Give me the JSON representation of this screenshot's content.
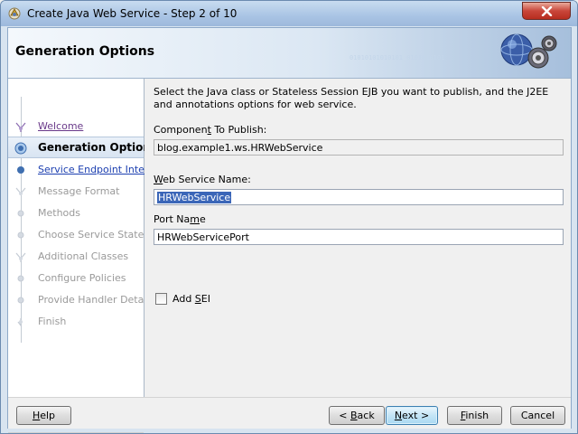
{
  "window": {
    "title": "Create Java Web Service - Step 2 of 10"
  },
  "header": {
    "title": "Generation Options",
    "decor_text": "01010101010101 0101010101"
  },
  "nav": {
    "items": [
      {
        "label": "Welcome",
        "state": "visited"
      },
      {
        "label": "Generation Options",
        "state": "active"
      },
      {
        "label": "Service Endpoint Interfa",
        "state": "link"
      },
      {
        "label": "Message Format",
        "state": "disabled"
      },
      {
        "label": "Methods",
        "state": "disabled"
      },
      {
        "label": "Choose Service State",
        "state": "disabled"
      },
      {
        "label": "Additional Classes",
        "state": "disabled"
      },
      {
        "label": "Configure Policies",
        "state": "disabled"
      },
      {
        "label": "Provide Handler Details",
        "state": "disabled"
      },
      {
        "label": "Finish",
        "state": "disabled"
      }
    ]
  },
  "form": {
    "description": "Select the Java class or Stateless Session EJB you want to publish, and the J2EE and annotations options for web service.",
    "component_label_pre": "Componen",
    "component_label_mn": "t",
    "component_label_post": " To Publish:",
    "component_value": "blog.example1.ws.HRWebService",
    "ws_name_label_mn": "W",
    "ws_name_label_post": "eb Service Name:",
    "ws_name_value": "HRWebService",
    "port_label_pre": "Port Na",
    "port_label_mn": "m",
    "port_label_post": "e",
    "port_value": "HRWebServicePort",
    "add_sei_pre": "Add ",
    "add_sei_mn": "S",
    "add_sei_post": "EI",
    "add_sei_checked": false
  },
  "buttons": {
    "help_mn": "H",
    "help_post": "elp",
    "back_pre": "< ",
    "back_mn": "B",
    "back_post": "ack",
    "next_mn": "N",
    "next_post": "ext >",
    "finish_mn": "F",
    "finish_post": "inish",
    "cancel": "Cancel"
  },
  "colors": {
    "selection": "#3b66b8",
    "link": "#1c3fb0",
    "visited": "#6a3a8a",
    "disabled": "#9a9a9a"
  }
}
